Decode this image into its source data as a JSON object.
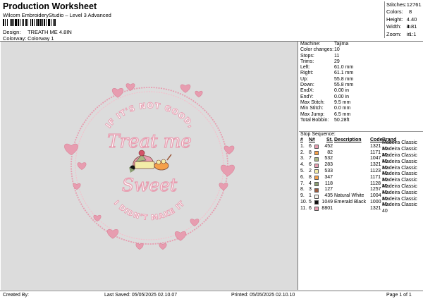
{
  "header": {
    "title": "Production Worksheet",
    "subtitle": "Wilcom EmbroideryStudio – Level 3 Advanced",
    "design_label": "Design:",
    "design_value": "TREATH ME 4.8IN",
    "colorway_label": "Colorway:",
    "colorway_value": "Colorway 1"
  },
  "stats": [
    {
      "k": "Stitches:",
      "v": "12761"
    },
    {
      "k": "Colors:",
      "v": "8"
    },
    {
      "k": "Height:",
      "v": "4.40 in"
    },
    {
      "k": "Width:",
      "v": "4.81 in"
    },
    {
      "k": "Zoom:",
      "v": "1:1"
    }
  ],
  "info": [
    {
      "k": "Machine:",
      "v": "Tajima"
    },
    {
      "k": "Color changes:",
      "v": "10"
    },
    {
      "k": "Stops:",
      "v": "11"
    },
    {
      "k": "Trims:",
      "v": "29"
    },
    {
      "k": "Left:",
      "v": "61.0 mm"
    },
    {
      "k": "Right:",
      "v": "61.1 mm"
    },
    {
      "k": "Up:",
      "v": "55.8 mm"
    },
    {
      "k": "Down:",
      "v": "55.8 mm"
    },
    {
      "k": "EndX:",
      "v": "0.00 in"
    },
    {
      "k": "EndY:",
      "v": "0.00 in"
    },
    {
      "k": "Max Stitch:",
      "v": "9.5 mm"
    },
    {
      "k": "Min Stitch:",
      "v": "0.0 mm"
    },
    {
      "k": "Max Jump:",
      "v": "6.5 mm"
    },
    {
      "k": "Total Bobbin:",
      "v": "50.28ft"
    }
  ],
  "sequence": {
    "title": "Stop Sequence:",
    "headers": {
      "num": "#",
      "n": "N#",
      "st": "St.",
      "desc": "Description",
      "code": "Code",
      "brand": "Brand"
    },
    "rows": [
      {
        "num": "1.",
        "n": "6",
        "color": "#e79db0",
        "st": "452",
        "desc": "",
        "code": "1321",
        "brand": "Madeira Classic 40"
      },
      {
        "num": "2.",
        "n": "8",
        "color": "#f5a04a",
        "st": "82",
        "desc": "",
        "code": "1171",
        "brand": "Madeira Classic 40"
      },
      {
        "num": "3.",
        "n": "7",
        "color": "#a9b784",
        "st": "532",
        "desc": "",
        "code": "1047",
        "brand": "Madeira Classic 40"
      },
      {
        "num": "4.",
        "n": "6",
        "color": "#e79db0",
        "st": "283",
        "desc": "",
        "code": "1321",
        "brand": "Madeira Classic 40"
      },
      {
        "num": "5.",
        "n": "2",
        "color": "#f3eca8",
        "st": "533",
        "desc": "",
        "code": "1123",
        "brand": "Madeira Classic 40"
      },
      {
        "num": "6.",
        "n": "8",
        "color": "#f5a04a",
        "st": "347",
        "desc": "",
        "code": "1171",
        "brand": "Madeira Classic 40"
      },
      {
        "num": "7.",
        "n": "4",
        "color": "#8a9d72",
        "st": "118",
        "desc": "",
        "code": "1128",
        "brand": "Madeira Classic 40"
      },
      {
        "num": "8.",
        "n": "3",
        "color": "#9b5a3c",
        "st": "127",
        "desc": "",
        "code": "1257",
        "brand": "Madeira Classic 40"
      },
      {
        "num": "9.",
        "n": "1",
        "color": "#f4f2ea",
        "st": "435",
        "desc": "Natural White",
        "code": "1004",
        "brand": "Madeira Classic 40"
      },
      {
        "num": "10.",
        "n": "5",
        "color": "#111111",
        "st": "1049",
        "desc": "Emerald Black",
        "code": "1000",
        "brand": "Madeira Classic 40"
      },
      {
        "num": "11.",
        "n": "6",
        "color": "#e79db0",
        "st": "8801",
        "desc": "",
        "code": "1321",
        "brand": "Madeira Classic 40"
      }
    ]
  },
  "design": {
    "text_top": "IF IT'S NOT GOOD,",
    "text_treat": "Treat me",
    "text_sweet": "Sweet",
    "text_bottom": "I DIDN'T MAKE IT",
    "pink": "#e79db0",
    "pink_light": "#f3c0cc",
    "pink_dark": "#d98498"
  },
  "footer": {
    "created": "Created By:",
    "saved": "Last Saved: 05/05/2025 02.10.07",
    "printed": "Printed: 05/05/2025 02.10.10",
    "page": "Page 1 of 1"
  }
}
